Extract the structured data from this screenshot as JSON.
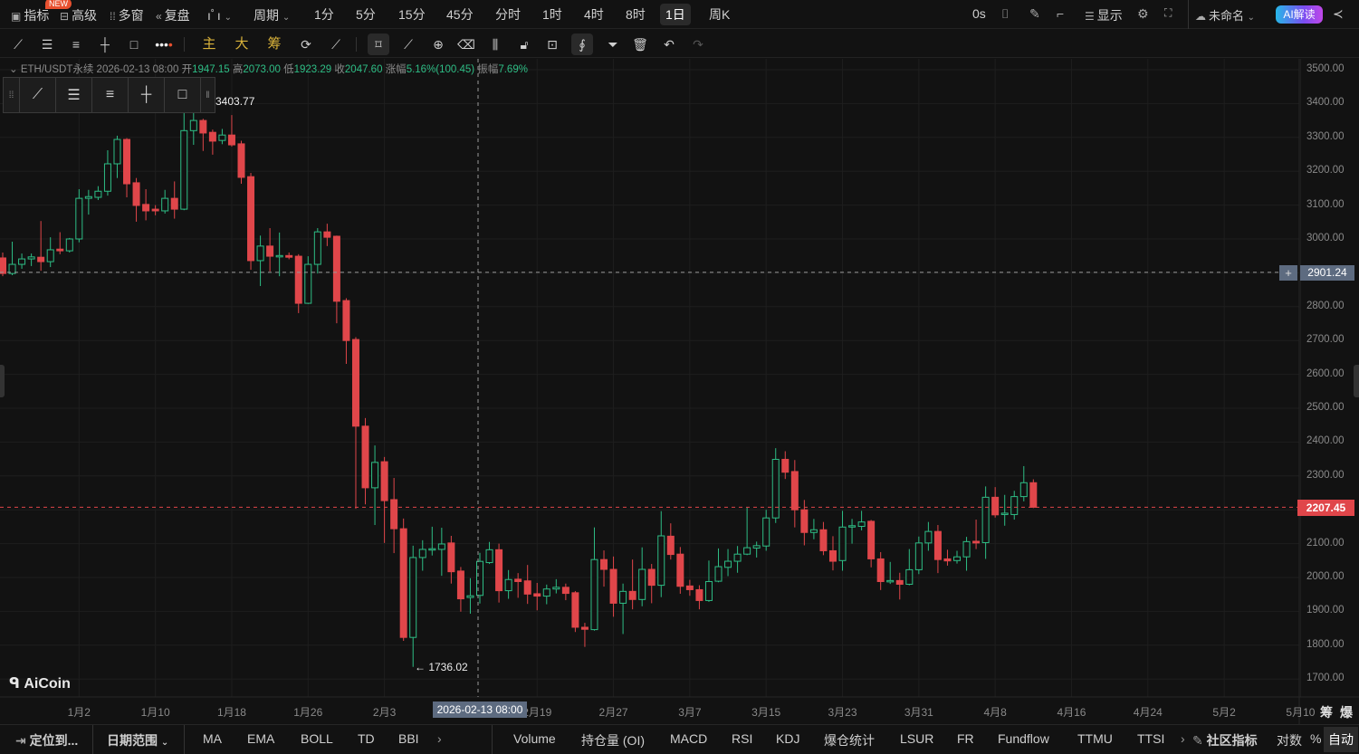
{
  "topbar": {
    "indicators": "指标",
    "new_badge": "NEW",
    "advanced": "高级",
    "multi_window": "多窗",
    "replay": "复盘",
    "period": "周期",
    "intervals": [
      "1分",
      "5分",
      "15分",
      "45分",
      "分时",
      "1时",
      "4时",
      "8时",
      "1日",
      "周K"
    ],
    "active_interval": "1日",
    "countdown": "0s",
    "display": "显示",
    "layout_name": "未命名",
    "ai_button": "AI解读"
  },
  "drawing_toolbar": {
    "main": "主",
    "big": "大",
    "chips": "筹"
  },
  "info": {
    "symbol": "ETH/USDT永续",
    "date": "2026-02-13 08:00",
    "open_label": "开",
    "open": "1947.15",
    "high_label": "高",
    "high": "2073.00",
    "low_label": "低",
    "low": "1923.29",
    "close_label": "收",
    "close": "2047.60",
    "change_label": "涨幅",
    "change": "5.16%(100.45)",
    "amp_label": "振幅",
    "amp": "7.69%"
  },
  "markers": {
    "high": "3403.77",
    "low": "← 1736.02",
    "crosshair_price": "2901.24",
    "crosshair_date": "2026-02-13 08:00",
    "last_price": "2207.45"
  },
  "watermark": "AiCoin",
  "axis_extra": [
    "筹",
    "爆"
  ],
  "bottom": {
    "locate": "定位到...",
    "date_range": "日期范围",
    "main_indicators": [
      "MA",
      "EMA",
      "BOLL",
      "TD",
      "BBI"
    ],
    "sub_indicators": [
      "Volume",
      "持仓量 (OI)",
      "MACD",
      "RSI",
      "KDJ",
      "爆仓统计",
      "LSUR",
      "FR",
      "Fundflow",
      "TTMU",
      "TTSI"
    ],
    "community": "社区指标",
    "log": "对数",
    "percent": "%",
    "auto": "自动"
  },
  "colors": {
    "up": "#2ebd85",
    "down": "#e0464a",
    "bg": "#121212",
    "crosshair_label": "#5d6b80"
  },
  "chart_data": {
    "type": "candlestick",
    "symbol": "ETH/USDT",
    "ylim": [
      1680,
      3530
    ],
    "yticks": [
      3500,
      3400,
      3300,
      3200,
      3100,
      3000,
      2900,
      2800,
      2700,
      2600,
      2500,
      2400,
      2300,
      2200,
      2100,
      2000,
      1900,
      1800,
      1700
    ],
    "ytick_labels": [
      "3500.00",
      "3400.00",
      "3300.00",
      "3200.00",
      "3100.00",
      "3000.00",
      "2900.00",
      "2800.00",
      "2700.00",
      "2600.00",
      "2500.00",
      "2400.00",
      "2300.00",
      "2200.00",
      "2100.00",
      "2000.00",
      "1900.00",
      "1800.00",
      "1700.00"
    ],
    "xticks": [
      {
        "i": 8,
        "label": "1月2"
      },
      {
        "i": 16,
        "label": "1月10"
      },
      {
        "i": 24,
        "label": "1月18"
      },
      {
        "i": 32,
        "label": "1月26"
      },
      {
        "i": 40,
        "label": "2月3"
      },
      {
        "i": 56,
        "label": "2月19"
      },
      {
        "i": 64,
        "label": "2月27"
      },
      {
        "i": 72,
        "label": "3月7"
      },
      {
        "i": 80,
        "label": "3月15"
      },
      {
        "i": 88,
        "label": "3月23"
      },
      {
        "i": 96,
        "label": "3月31"
      },
      {
        "i": 104,
        "label": "4月8"
      },
      {
        "i": 112,
        "label": "4月16"
      },
      {
        "i": 120,
        "label": "4月24"
      },
      {
        "i": 128,
        "label": "5月2"
      },
      {
        "i": 136,
        "label": "5月10"
      }
    ],
    "crosshair_index": 50,
    "crosshair_price": 2901.24,
    "last_price": 2207.45,
    "ohlc": [
      [
        2944,
        2960,
        2890,
        2898
      ],
      [
        2898,
        2992,
        2893,
        2925
      ],
      [
        2925,
        2957,
        2912,
        2941
      ],
      [
        2941,
        2957,
        2920,
        2947
      ],
      [
        2946,
        3053,
        2906,
        2933
      ],
      [
        2933,
        3005,
        2917,
        2968
      ],
      [
        2970,
        3020,
        2955,
        2965
      ],
      [
        2965,
        3003,
        2960,
        3000
      ],
      [
        3000,
        3147,
        2990,
        3120
      ],
      [
        3120,
        3145,
        3072,
        3125
      ],
      [
        3123,
        3156,
        3115,
        3141
      ],
      [
        3141,
        3262,
        3128,
        3222
      ],
      [
        3222,
        3305,
        3180,
        3294
      ],
      [
        3294,
        3298,
        3123,
        3163
      ],
      [
        3166,
        3180,
        3051,
        3099
      ],
      [
        3102,
        3147,
        3055,
        3083
      ],
      [
        3088,
        3100,
        3070,
        3083
      ],
      [
        3083,
        3145,
        3075,
        3120
      ],
      [
        3120,
        3170,
        3060,
        3088
      ],
      [
        3088,
        3400,
        3085,
        3320
      ],
      [
        3320,
        3403.77,
        3278,
        3350
      ],
      [
        3350,
        3355,
        3260,
        3313
      ],
      [
        3315,
        3323,
        3249,
        3289
      ],
      [
        3291,
        3325,
        3280,
        3307
      ],
      [
        3307,
        3366,
        3273,
        3278
      ],
      [
        3281,
        3290,
        3163,
        3182
      ],
      [
        3184,
        3195,
        2909,
        2936
      ],
      [
        2936,
        3010,
        2861,
        2979
      ],
      [
        2979,
        3032,
        2904,
        2949
      ],
      [
        2947,
        3019,
        2890,
        2951
      ],
      [
        2951,
        2960,
        2940,
        2946
      ],
      [
        2949,
        2955,
        2781,
        2810
      ],
      [
        2810,
        2949,
        2808,
        2925
      ],
      [
        2925,
        3032,
        2898,
        3021
      ],
      [
        3021,
        3045,
        2979,
        3005
      ],
      [
        3008,
        3010,
        2751,
        2816
      ],
      [
        2818,
        2825,
        2631,
        2700
      ],
      [
        2703,
        2710,
        2203,
        2447
      ],
      [
        2447,
        2471,
        2216,
        2265
      ],
      [
        2265,
        2390,
        2155,
        2340
      ],
      [
        2342,
        2356,
        2102,
        2227
      ],
      [
        2230,
        2294,
        2072,
        2144
      ],
      [
        2144,
        2174,
        1813,
        1823
      ],
      [
        1823,
        2094,
        1736.02,
        2059
      ],
      [
        2059,
        2110,
        2020,
        2083
      ],
      [
        2081,
        2150,
        2065,
        2085
      ],
      [
        2083,
        2147,
        2005,
        2099
      ],
      [
        2102,
        2123,
        1982,
        2017
      ],
      [
        2019,
        2031,
        1899,
        1937
      ],
      [
        1941,
        1998,
        1893,
        1946
      ],
      [
        1947.15,
        2073,
        1923.29,
        2047.6
      ],
      [
        2044,
        2105,
        2040,
        2082
      ],
      [
        2082,
        2100,
        1926,
        1961
      ],
      [
        1961,
        2022,
        1937,
        1994
      ],
      [
        1995,
        2013,
        1940,
        1988
      ],
      [
        1990,
        2037,
        1922,
        1951
      ],
      [
        1952,
        1984,
        1903,
        1945
      ],
      [
        1945,
        1979,
        1921,
        1966
      ],
      [
        1966,
        1995,
        1953,
        1971
      ],
      [
        1971,
        1982,
        1933,
        1953
      ],
      [
        1955,
        1960,
        1839,
        1853
      ],
      [
        1853,
        1866,
        1795,
        1847
      ],
      [
        1846,
        2148,
        1843,
        2053
      ],
      [
        2053,
        2080,
        1973,
        2024
      ],
      [
        2024,
        2062,
        1884,
        1924
      ],
      [
        1924,
        1982,
        1833,
        1959
      ],
      [
        1959,
        2053,
        1906,
        1935
      ],
      [
        1935,
        2089,
        1915,
        2024
      ],
      [
        2024,
        2040,
        1924,
        1977
      ],
      [
        1977,
        2196,
        1942,
        2123
      ],
      [
        2122,
        2160,
        2053,
        2068
      ],
      [
        2069,
        2090,
        1952,
        1974
      ],
      [
        1975,
        1993,
        1946,
        1964
      ],
      [
        1964,
        1977,
        1906,
        1932
      ],
      [
        1932,
        2050,
        1928,
        1988
      ],
      [
        1989,
        2086,
        1986,
        2032
      ],
      [
        2030,
        2084,
        2004,
        2048
      ],
      [
        2048,
        2093,
        2014,
        2069
      ],
      [
        2069,
        2207,
        2066,
        2088
      ],
      [
        2087,
        2106,
        2059,
        2094
      ],
      [
        2093,
        2200,
        2079,
        2176
      ],
      [
        2176,
        2382,
        2161,
        2349
      ],
      [
        2349,
        2373,
        2291,
        2311
      ],
      [
        2313,
        2347,
        2148,
        2200
      ],
      [
        2200,
        2229,
        2095,
        2133
      ],
      [
        2133,
        2173,
        2113,
        2141
      ],
      [
        2141,
        2164,
        2066,
        2079
      ],
      [
        2079,
        2122,
        2021,
        2048
      ],
      [
        2050,
        2197,
        2020,
        2149
      ],
      [
        2149,
        2173,
        2100,
        2153
      ],
      [
        2151,
        2197,
        2139,
        2164
      ],
      [
        2166,
        2170,
        2030,
        2055
      ],
      [
        2055,
        2075,
        1963,
        1988
      ],
      [
        1987,
        2046,
        1981,
        1991
      ],
      [
        1991,
        2014,
        1935,
        1980
      ],
      [
        1980,
        2084,
        1977,
        2023
      ],
      [
        2023,
        2121,
        2010,
        2102
      ],
      [
        2102,
        2164,
        2079,
        2136
      ],
      [
        2136,
        2155,
        2013,
        2053
      ],
      [
        2055,
        2082,
        2035,
        2049
      ],
      [
        2050,
        2079,
        2041,
        2061
      ],
      [
        2061,
        2120,
        2020,
        2106
      ],
      [
        2107,
        2171,
        2084,
        2102
      ],
      [
        2103,
        2269,
        2055,
        2237
      ],
      [
        2237,
        2267,
        2177,
        2185
      ],
      [
        2186,
        2244,
        2153,
        2190
      ],
      [
        2186,
        2256,
        2171,
        2239
      ],
      [
        2239,
        2329,
        2225,
        2280
      ],
      [
        2280,
        2290,
        2205,
        2207.45
      ]
    ]
  }
}
